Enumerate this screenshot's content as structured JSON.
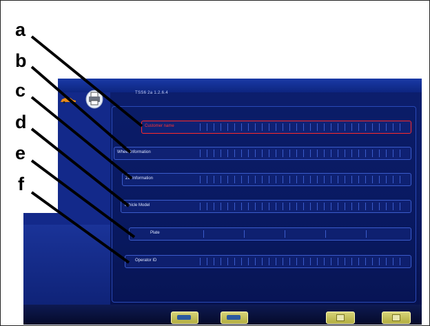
{
  "header": {
    "text": "TSS6 2a  1.2.6.4"
  },
  "fields": [
    {
      "label": "Customer name",
      "active": true
    },
    {
      "label": "Wheel Information",
      "active": false
    },
    {
      "label": "Zin Information",
      "active": false
    },
    {
      "label": "Vehicle Model",
      "active": false
    },
    {
      "label": "Plate",
      "active": false
    },
    {
      "label": "Operator ID",
      "active": false
    }
  ],
  "callouts": [
    "a",
    "b",
    "c",
    "d",
    "e",
    "f"
  ],
  "icons": {
    "car": "car-icon",
    "printer": "printer-icon",
    "bottom_buttons": [
      "keyboard-icon",
      "refresh-icon",
      "screen-icon",
      "exit-icon"
    ]
  },
  "colors": {
    "screen_bg": "#0c1f6e",
    "field_border": "#3b5ccc",
    "active_field": "#ff2b2b",
    "button": "#d7d37a"
  }
}
